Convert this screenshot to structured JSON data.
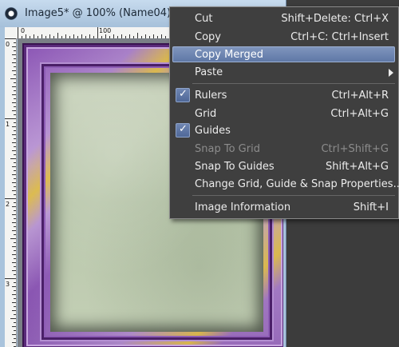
{
  "window": {
    "title": "Image5* @ 100% (Name04)"
  },
  "ruler": {
    "h_labels": [
      "0",
      "100"
    ],
    "v_labels": [
      "0",
      "1",
      "2",
      "3"
    ]
  },
  "context_menu": {
    "items": [
      {
        "label": "Cut",
        "shortcut": "Shift+Delete: Ctrl+X"
      },
      {
        "label": "Copy",
        "shortcut": "Ctrl+C: Ctrl+Insert"
      },
      {
        "label": "Copy Merged",
        "shortcut": ""
      },
      {
        "label": "Paste",
        "shortcut": ""
      },
      {
        "label": "Rulers",
        "shortcut": "Ctrl+Alt+R"
      },
      {
        "label": "Grid",
        "shortcut": "Ctrl+Alt+G"
      },
      {
        "label": "Guides",
        "shortcut": ""
      },
      {
        "label": "Snap To Grid",
        "shortcut": "Ctrl+Shift+G"
      },
      {
        "label": "Snap To Guides",
        "shortcut": "Shift+Alt+G"
      },
      {
        "label": "Change Grid, Guide & Snap Properties...",
        "shortcut": ""
      },
      {
        "label": "Image Information",
        "shortcut": "Shift+I"
      }
    ],
    "check_glyph": "✓"
  },
  "colors": {
    "menu_bg": "#3f3f3f",
    "highlight": "#6a82b0",
    "title_bar": "#b5cde4",
    "frame_purple": "#8a54b4",
    "paper_green": "#c0cbb2"
  }
}
